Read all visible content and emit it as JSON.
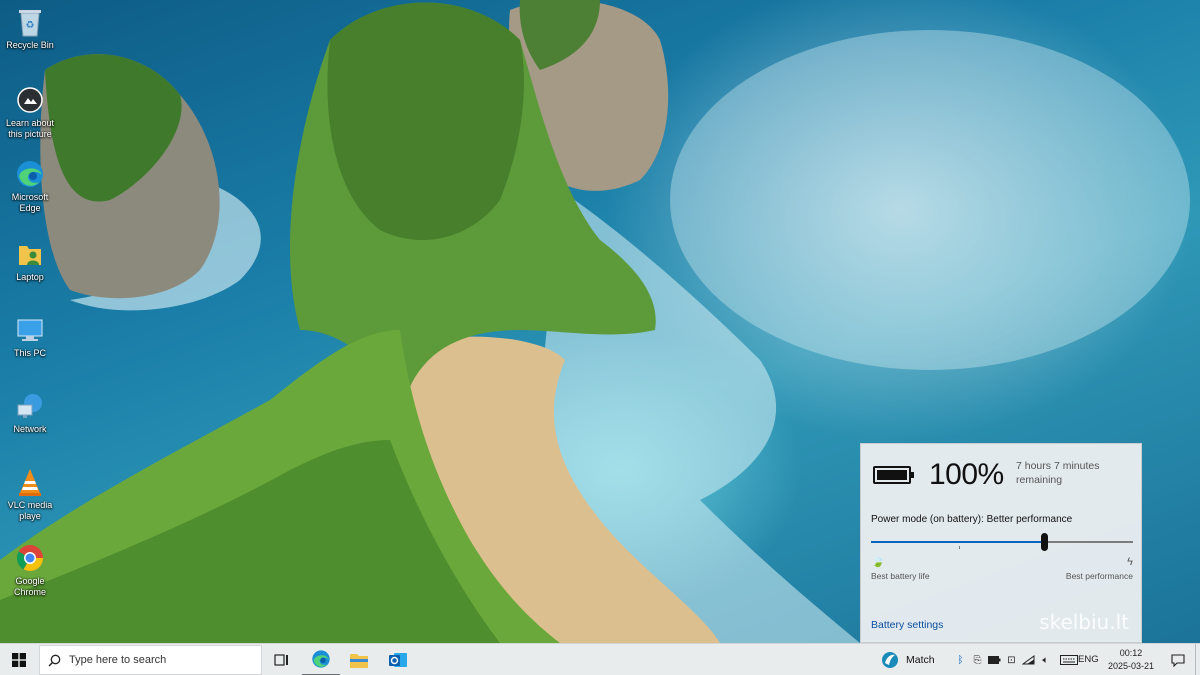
{
  "desktop": {
    "icons": [
      {
        "label": "Recycle Bin",
        "icon": "recycle-bin-icon"
      },
      {
        "label": "Learn about this picture",
        "icon": "camera-icon"
      },
      {
        "label": "Microsoft Edge",
        "icon": "edge-icon"
      },
      {
        "label": "Laptop",
        "icon": "user-folder-icon"
      },
      {
        "label": "This PC",
        "icon": "computer-icon"
      },
      {
        "label": "Network",
        "icon": "network-icon"
      },
      {
        "label": "VLC media playe",
        "icon": "vlc-icon"
      },
      {
        "label": "Google Chrome",
        "icon": "chrome-icon"
      }
    ]
  },
  "battery_flyout": {
    "percent": "100%",
    "remaining": "7 hours 7 minutes remaining",
    "power_mode_label": "Power mode (on battery): Better performance",
    "slider_level": 0.66,
    "left_label": "Best battery life",
    "right_label": "Best performance",
    "settings_link": "Battery settings",
    "watermark": "skelbiu.lt"
  },
  "taskbar": {
    "search_placeholder": "Type here to search",
    "apps": [
      "task-view",
      "edge",
      "file-explorer",
      "outlook"
    ],
    "weather_label": "Match",
    "language": "ENG",
    "time": "00:12",
    "date": "2025-03-21"
  },
  "colors": {
    "accent": "#0a64c0",
    "taskbar_bg": "#e9eced",
    "flyout_bg": "#eef0f2"
  }
}
